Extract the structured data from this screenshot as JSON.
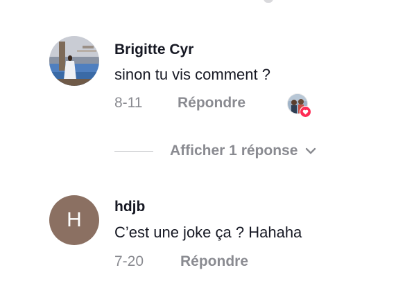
{
  "comments": [
    {
      "username": "Brigitte Cyr",
      "text": "sinon tu vis comment ?",
      "date": "8-11",
      "reply_label": "Répondre",
      "avatar": "photo-avatar",
      "liked_by_creator": true,
      "view_replies_label": "Afficher 1 réponse"
    },
    {
      "username": "hdjb",
      "text": "C’est une joke ça ? Hahaha",
      "date": "7-20",
      "reply_label": "Répondre",
      "avatar_letter": "H",
      "avatar_color": "#8b7062"
    }
  ],
  "icons": {
    "heart": "heart-icon",
    "chevron": "chevron-down-icon"
  },
  "colors": {
    "text": "#161823",
    "secondary": "#8a8b91",
    "heart": "#fe2c55"
  }
}
